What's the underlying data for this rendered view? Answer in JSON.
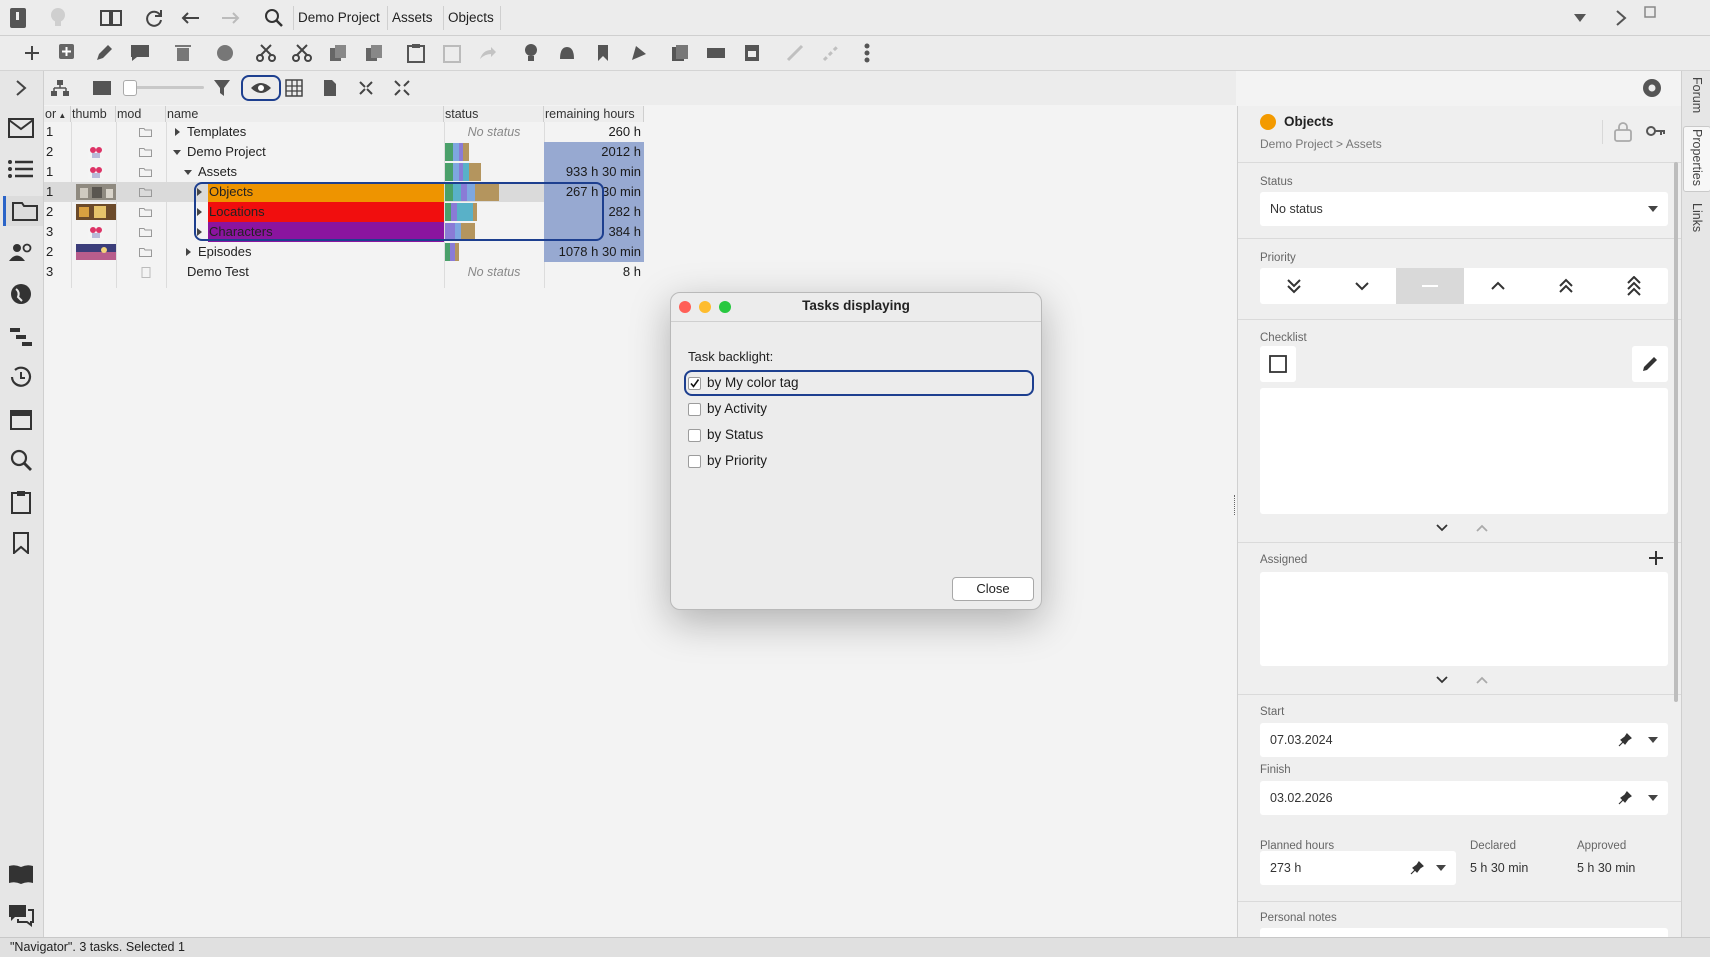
{
  "breadcrumbs": [
    "Demo Project",
    "Assets",
    "Objects"
  ],
  "columns": {
    "order": "or",
    "thumb": "thumb",
    "mod": "mod",
    "name": "name",
    "status": "status",
    "remaining": "remaining hours"
  },
  "rows": [
    {
      "order": "1",
      "name": "Templates",
      "status": "No status",
      "hours": "260 h",
      "level": 0,
      "expander": "right",
      "highlight": ""
    },
    {
      "order": "2",
      "name": "Demo Project",
      "status": "",
      "hours": "2012 h",
      "level": 0,
      "expander": "down",
      "highlight": ""
    },
    {
      "order": "1",
      "name": "Assets",
      "status": "",
      "hours": "933 h 30 min",
      "level": 1,
      "expander": "down",
      "highlight": ""
    },
    {
      "order": "1",
      "name": "Objects",
      "status": "",
      "hours": "267 h 30 min",
      "level": 2,
      "expander": "right",
      "highlight": "#ee9400"
    },
    {
      "order": "2",
      "name": "Locations",
      "status": "",
      "hours": "282 h",
      "level": 2,
      "expander": "right",
      "highlight": "#f10e0e"
    },
    {
      "order": "3",
      "name": "Characters",
      "status": "",
      "hours": "384 h",
      "level": 2,
      "expander": "right",
      "highlight": "#8b149f"
    },
    {
      "order": "2",
      "name": "Episodes",
      "status": "",
      "hours": "1078 h 30 min",
      "level": 1,
      "expander": "right",
      "highlight": ""
    },
    {
      "order": "3",
      "name": "Demo Test",
      "status": "No status",
      "hours": "8 h",
      "level": 0,
      "expander": "",
      "highlight": ""
    }
  ],
  "dialog": {
    "title": "Tasks displaying",
    "section_label": "Task backlight:",
    "options": [
      {
        "label": "by My color tag",
        "checked": true
      },
      {
        "label": "by Activity",
        "checked": false
      },
      {
        "label": "by Status",
        "checked": false
      },
      {
        "label": "by Priority",
        "checked": false
      }
    ],
    "close_label": "Close"
  },
  "panel": {
    "title": "Objects",
    "title_dot_color": "#f39a00",
    "path": "Demo Project > Assets",
    "status_label": "Status",
    "status_value": "No status",
    "priority_label": "Priority",
    "checklist_label": "Checklist",
    "assigned_label": "Assigned",
    "start_label": "Start",
    "start_value": "07.03.2024",
    "finish_label": "Finish",
    "finish_value": "03.02.2026",
    "planned_label": "Planned hours",
    "planned_value": "273 h",
    "declared_label": "Declared",
    "declared_value": "5 h 30 min",
    "approved_label": "Approved",
    "approved_value": "5 h 30 min",
    "notes_label": "Personal notes"
  },
  "side_tabs": [
    "Forum",
    "Properties",
    "Links"
  ],
  "status_bar": "\"Navigator\". 3 tasks. Selected 1",
  "colors": {
    "hours_bg": "#97a9d1",
    "focus_ring": "#1d3f8f"
  }
}
